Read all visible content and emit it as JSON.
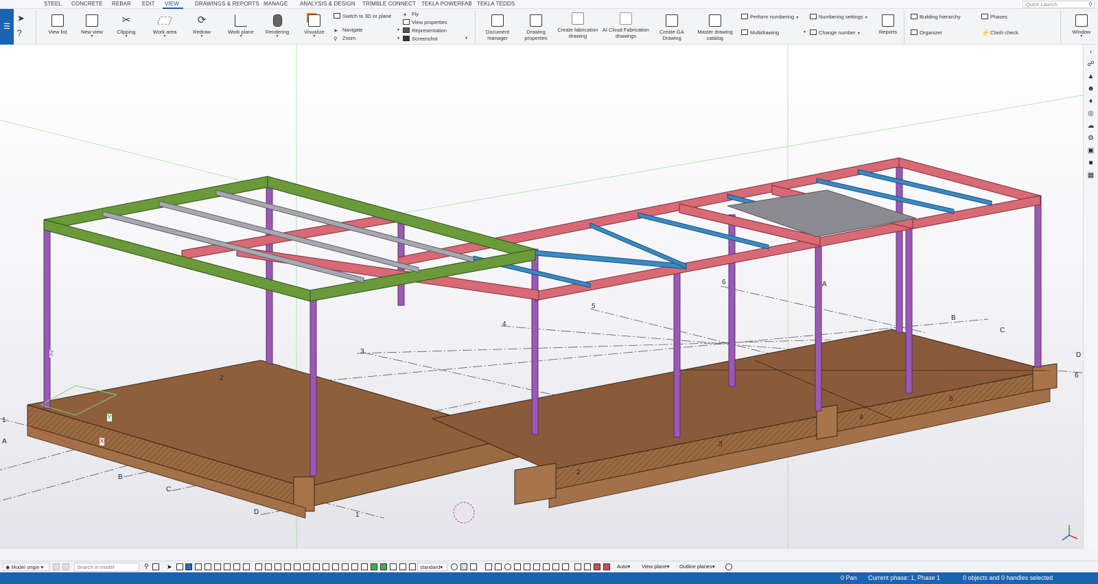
{
  "menu": {
    "tabs": [
      "STEEL",
      "CONCRETE",
      "REBAR",
      "EDIT",
      "VIEW",
      "DRAWINGS & REPORTS",
      "MANAGE",
      "ANALYSIS & DESIGN",
      "TRIMBLE CONNECT",
      "TEKLA POWERFAB",
      "TEKLA TEDDS"
    ],
    "active_tab": "VIEW",
    "quick_launch_placeholder": "Quick Launch"
  },
  "ribbon": {
    "large_buttons": [
      {
        "label": "View list",
        "icon": "view-list-icon"
      },
      {
        "label": "New view",
        "icon": "new-view-icon"
      },
      {
        "label": "Clipping",
        "icon": "scissors-icon"
      },
      {
        "label": "Work area",
        "icon": "work-area-icon"
      },
      {
        "label": "Redraw",
        "icon": "redraw-icon"
      },
      {
        "label": "Work plane",
        "icon": "work-plane-icon"
      },
      {
        "label": "Rendering",
        "icon": "rendering-icon"
      },
      {
        "label": "Visualize",
        "icon": "visualize-icon"
      }
    ],
    "small_buttons_a": [
      "Switch to 3D or plane",
      "Navigate",
      "Zoom"
    ],
    "small_buttons_b": [
      "Fly",
      "View properties",
      "Representation",
      "Screenshot"
    ],
    "drawing_buttons": [
      {
        "label": "Document\nmanager",
        "icon": "document-manager-icon"
      },
      {
        "label": "Drawing\nproperties",
        "icon": "drawing-properties-icon"
      },
      {
        "label": "Create fabrication\ndrawing",
        "icon": "fabrication-drawing-icon"
      },
      {
        "label": "AI Cloud Fabrication\ndrawings",
        "icon": "ai-cloud-icon"
      },
      {
        "label": "Create GA\nDrawing",
        "icon": "ga-drawing-icon"
      },
      {
        "label": "Master drawing\ncatalog",
        "icon": "drawing-catalog-icon"
      }
    ],
    "numbering_buttons": [
      "Perform numbering",
      "Multidrawing",
      "Numbering settings",
      "Change number"
    ],
    "reports_label": "Reports",
    "manage_buttons": [
      "Building hierarchy",
      "Organizer",
      "Phases",
      "Clash check"
    ],
    "window_label": "Window"
  },
  "viewport": {
    "grid_labels": [
      "1",
      "A",
      "B",
      "C",
      "D",
      "1",
      "2",
      "3",
      "4",
      "5",
      "6",
      "A",
      "B",
      "C",
      "D",
      "6",
      "2",
      "3",
      "4",
      "5"
    ],
    "axis_labels": {
      "x": "X",
      "y": "Y",
      "z": "Z"
    },
    "colors": {
      "beam_green": "#6a9a3a",
      "beam_red": "#d86a76",
      "beam_blue": "#3a8ac4",
      "beam_gray": "#a8a8b0",
      "column_purple": "#9b59b6",
      "footing": "#9a6a42",
      "slab": "#8a5a3a"
    }
  },
  "side_panel_icons": [
    "collapse-icon",
    "link-icon",
    "grad-cap-icon",
    "users-icon",
    "bell-icon",
    "globe-icon",
    "cloud-icon",
    "gear-icon",
    "layers-icon",
    "cube-icon",
    "components-icon"
  ],
  "bottom_toolbar": {
    "origin_label": "Model origin",
    "search_placeholder": "Search in model",
    "standard_label": "standard",
    "auto_label": "Auto",
    "view_plane_label": "View plane",
    "outline_label": "Outline planes"
  },
  "status": {
    "pan": "0 Pan",
    "phase": "Current phase: 1, Phase 1",
    "selection": "0 objects and 0 handles selected"
  }
}
